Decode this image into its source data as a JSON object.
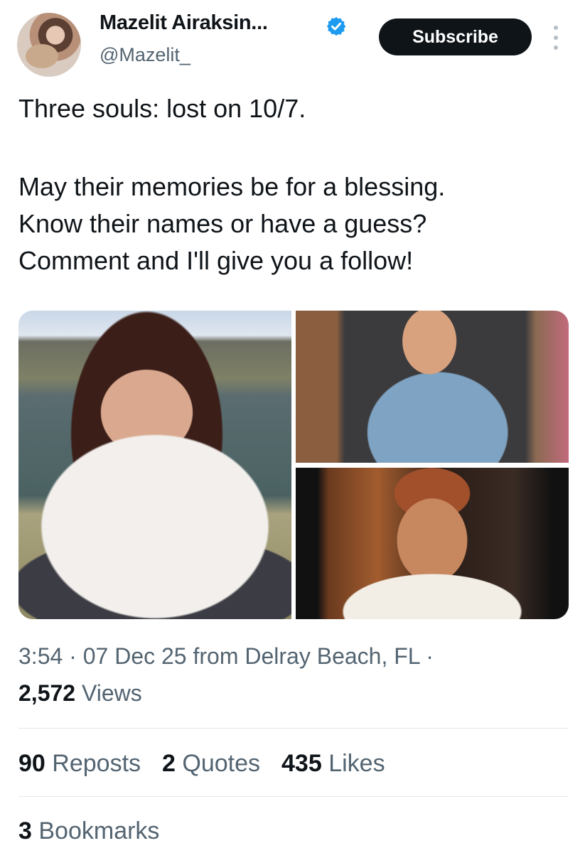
{
  "author": {
    "display_name": "Mazelit Airaksin...",
    "handle": "@Mazelit_",
    "verified": true
  },
  "header": {
    "subscribe_label": "Subscribe",
    "more_icon": "more-vertical-icon"
  },
  "tweet": {
    "line1": "Three souls: lost on 10/7.",
    "line2": "May their memories be for a blessing.",
    "line3": "Know their names or have a guess?",
    "line4": "Comment and I'll give you a follow!"
  },
  "media": [
    {
      "description": "photo of a woman smiling by a lake"
    },
    {
      "description": "photo of a woman in overalls"
    },
    {
      "description": "photo of a smiling man"
    }
  ],
  "meta": {
    "time": "3:54",
    "date": "07 Dec 25",
    "location_text": "from Delray Beach, FL",
    "views_count": "2,572",
    "views_label": "Views"
  },
  "stats": {
    "reposts_count": "90",
    "reposts_label": "Reposts",
    "quotes_count": "2",
    "quotes_label": "Quotes",
    "likes_count": "435",
    "likes_label": "Likes",
    "bookmarks_count": "3",
    "bookmarks_label": "Bookmarks"
  },
  "colors": {
    "verified_blue": "#1d9bf0",
    "text_primary": "#0f1419",
    "text_secondary": "#536471",
    "button_bg": "#0f1419"
  }
}
